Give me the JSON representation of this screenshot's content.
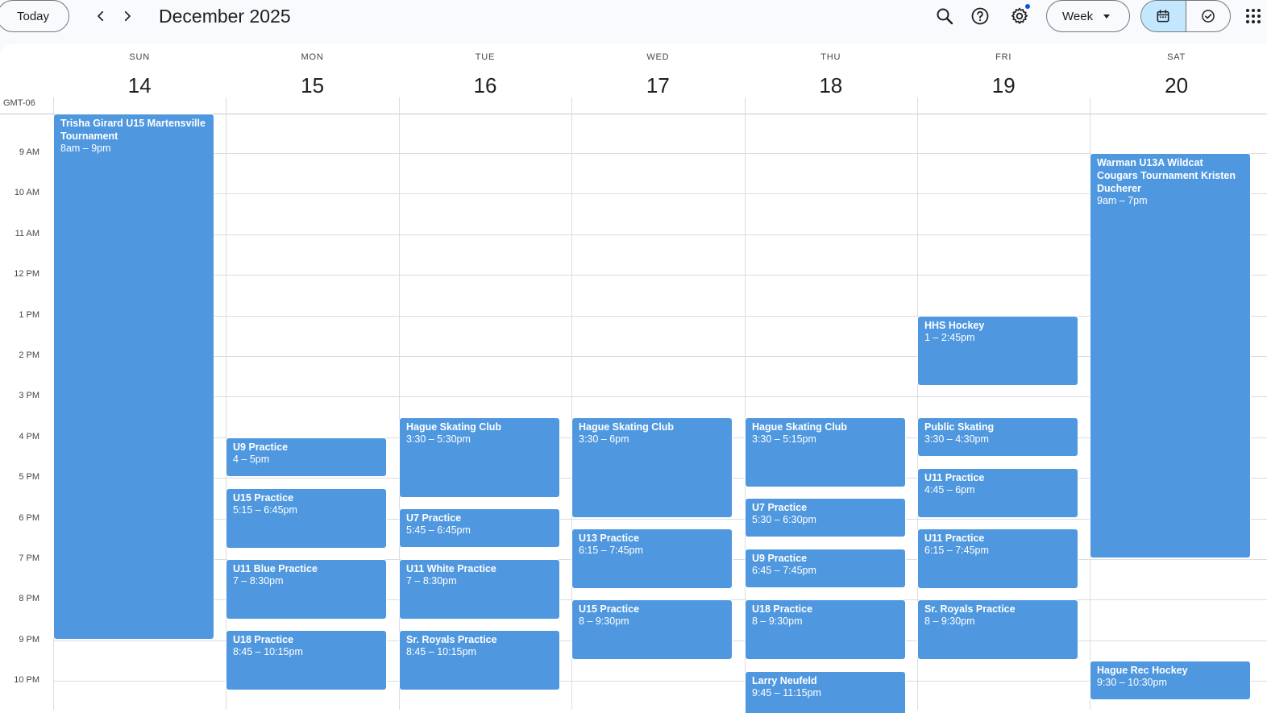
{
  "toolbar": {
    "today_label": "Today",
    "month_title": "December 2025",
    "view_label": "Week"
  },
  "icons": {
    "prev": "chevron-left-icon",
    "next": "chevron-right-icon",
    "search": "search-icon",
    "help": "help-icon",
    "settings": "gear-icon",
    "calendar": "calendar-icon",
    "tasks": "check-circle-icon",
    "apps": "apps-grid-icon"
  },
  "colors": {
    "event": "#4f98df",
    "active_toggle": "#c2e7ff",
    "notification_dot": "#0b57d0"
  },
  "timezone": "GMT-06",
  "days": [
    {
      "dow": "SUN",
      "num": "14"
    },
    {
      "dow": "MON",
      "num": "15"
    },
    {
      "dow": "TUE",
      "num": "16"
    },
    {
      "dow": "WED",
      "num": "17"
    },
    {
      "dow": "THU",
      "num": "18"
    },
    {
      "dow": "FRI",
      "num": "19"
    },
    {
      "dow": "SAT",
      "num": "20"
    }
  ],
  "time_labels": [
    "9 AM",
    "10 AM",
    "11 AM",
    "12 PM",
    "1 PM",
    "2 PM",
    "3 PM",
    "4 PM",
    "5 PM",
    "6 PM",
    "7 PM",
    "8 PM",
    "9 PM",
    "10 PM"
  ],
  "events": [
    {
      "day": 0,
      "start": 8,
      "end": 21,
      "title": "Trisha Girard U15 Martensville Tournament",
      "time": "8am – 9pm"
    },
    {
      "day": 1,
      "start": 16,
      "end": 17,
      "title": "U9 Practice",
      "time": "4 – 5pm"
    },
    {
      "day": 1,
      "start": 17.25,
      "end": 18.75,
      "title": "U15 Practice",
      "time": "5:15 – 6:45pm"
    },
    {
      "day": 1,
      "start": 19,
      "end": 20.5,
      "title": "U11 Blue Practice",
      "time": "7 – 8:30pm"
    },
    {
      "day": 1,
      "start": 20.75,
      "end": 22.25,
      "title": "U18 Practice",
      "time": "8:45 – 10:15pm"
    },
    {
      "day": 2,
      "start": 15.5,
      "end": 17.5,
      "title": "Hague Skating Club",
      "time": "3:30 – 5:30pm"
    },
    {
      "day": 2,
      "start": 17.75,
      "end": 18.75,
      "title": "U7 Practice",
      "time": "5:45 – 6:45pm"
    },
    {
      "day": 2,
      "start": 19,
      "end": 20.5,
      "title": "U11 White Practice",
      "time": "7 – 8:30pm"
    },
    {
      "day": 2,
      "start": 20.75,
      "end": 22.25,
      "title": "Sr. Royals Practice",
      "time": "8:45 – 10:15pm"
    },
    {
      "day": 3,
      "start": 15.5,
      "end": 18,
      "title": "Hague Skating Club",
      "time": "3:30 – 6pm"
    },
    {
      "day": 3,
      "start": 18.25,
      "end": 19.75,
      "title": "U13 Practice",
      "time": "6:15 – 7:45pm"
    },
    {
      "day": 3,
      "start": 20,
      "end": 21.5,
      "title": "U15 Practice",
      "time": "8 – 9:30pm"
    },
    {
      "day": 4,
      "start": 15.5,
      "end": 17.25,
      "title": "Hague Skating Club",
      "time": "3:30 – 5:15pm"
    },
    {
      "day": 4,
      "start": 17.5,
      "end": 18.5,
      "title": "U7 Practice",
      "time": "5:30 – 6:30pm"
    },
    {
      "day": 4,
      "start": 18.75,
      "end": 19.75,
      "title": "U9 Practice",
      "time": "6:45 – 7:45pm"
    },
    {
      "day": 4,
      "start": 20,
      "end": 21.5,
      "title": "U18 Practice",
      "time": "8 – 9:30pm"
    },
    {
      "day": 4,
      "start": 21.75,
      "end": 23.25,
      "title": "Larry Neufeld",
      "time": "9:45 – 11:15pm"
    },
    {
      "day": 5,
      "start": 13,
      "end": 14.75,
      "title": "HHS Hockey",
      "time": "1 – 2:45pm"
    },
    {
      "day": 5,
      "start": 15.5,
      "end": 16.5,
      "title": "Public Skating",
      "time": "3:30 – 4:30pm"
    },
    {
      "day": 5,
      "start": 16.75,
      "end": 18,
      "title": "U11 Practice",
      "time": "4:45 – 6pm"
    },
    {
      "day": 5,
      "start": 18.25,
      "end": 19.75,
      "title": "U11 Practice",
      "time": "6:15 – 7:45pm"
    },
    {
      "day": 5,
      "start": 20,
      "end": 21.5,
      "title": "Sr. Royals Practice",
      "time": "8 – 9:30pm"
    },
    {
      "day": 6,
      "start": 9,
      "end": 19,
      "title": "Warman U13A Wildcat Cougars Tournament Kristen Ducherer",
      "time": "9am – 7pm"
    },
    {
      "day": 6,
      "start": 21.5,
      "end": 22.5,
      "title": "Hague Rec Hockey",
      "time": "9:30 – 10:30pm"
    }
  ]
}
